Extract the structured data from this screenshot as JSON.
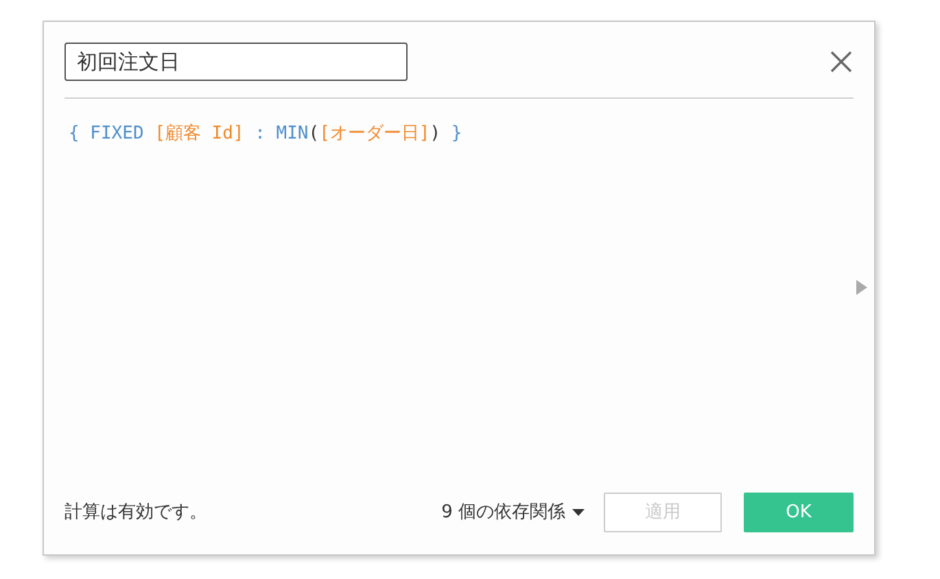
{
  "name_field": {
    "value": "初回注文日"
  },
  "formula": [
    {
      "text": "{ FIXED ",
      "kind": "keyword"
    },
    {
      "text": "[顧客 Id]",
      "kind": "field"
    },
    {
      "text": " : MIN",
      "kind": "keyword"
    },
    {
      "text": "(",
      "kind": "paren"
    },
    {
      "text": "[オーダー日]",
      "kind": "field"
    },
    {
      "text": ")",
      "kind": "paren"
    },
    {
      "text": " }",
      "kind": "keyword"
    }
  ],
  "status": "計算は有効です。",
  "dependencies": "9 個の依存関係",
  "buttons": [
    {
      "label": "適用",
      "kind": "secondary",
      "disabled": true
    },
    {
      "label": "OK",
      "kind": "primary",
      "disabled": false
    }
  ]
}
